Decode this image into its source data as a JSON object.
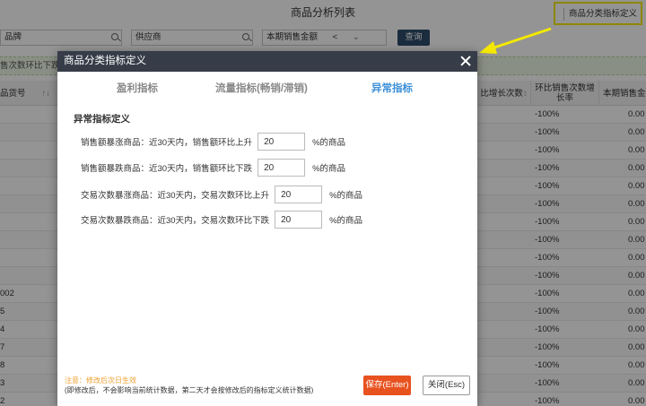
{
  "page": {
    "title": "商品分析列表",
    "def_button": "商品分类指标定义"
  },
  "filters": {
    "brand": "品牌",
    "supplier": "供应商",
    "sales": "本期销售金额",
    "sales_op": "<",
    "sales_chevron": "⌄",
    "query": "查询"
  },
  "notice": "售次数环比下跌",
  "table": {
    "headers": {
      "sku": "品货号",
      "sort_icon": "↑↓",
      "col_growth": "比增长次数",
      "col_growth_sort": "↕",
      "col_ratio": "环比销售次数增长率",
      "col_amount": "本期销售金"
    },
    "rows": [
      {
        "sku": "",
        "ratio": "-100%",
        "amount": "0.00"
      },
      {
        "sku": "",
        "ratio": "-100%",
        "amount": "0.00"
      },
      {
        "sku": "",
        "ratio": "-100%",
        "amount": "0.00"
      },
      {
        "sku": "",
        "ratio": "-100%",
        "amount": "0.00"
      },
      {
        "sku": "",
        "ratio": "-100%",
        "amount": "0.00"
      },
      {
        "sku": "",
        "ratio": "-100%",
        "amount": "0.00"
      },
      {
        "sku": "",
        "ratio": "-100%",
        "amount": "0.00"
      },
      {
        "sku": "",
        "ratio": "-100%",
        "amount": "0.00"
      },
      {
        "sku": "",
        "ratio": "-100%",
        "amount": "0.00"
      },
      {
        "sku": "",
        "ratio": "-100%",
        "amount": "0.00"
      },
      {
        "sku": "002",
        "ratio": "-100%",
        "amount": "0.00"
      },
      {
        "sku": "5",
        "ratio": "-100%",
        "amount": "0.00"
      },
      {
        "sku": "4",
        "ratio": "-100%",
        "amount": "0.00"
      },
      {
        "sku": "7",
        "ratio": "-100%",
        "amount": "0.00"
      },
      {
        "sku": "8",
        "ratio": "-100%",
        "amount": "0.00"
      },
      {
        "sku": "3",
        "ratio": "-100%",
        "amount": "0.00"
      },
      {
        "sku": "2",
        "ratio": "-100%",
        "amount": "0.00"
      }
    ]
  },
  "modal": {
    "title": "商品分类指标定义",
    "tabs": [
      {
        "label": "盈利指标",
        "active": false
      },
      {
        "label": "流量指标(畅销/滞销)",
        "active": false
      },
      {
        "label": "异常指标",
        "active": true
      }
    ],
    "section_title": "异常指标定义",
    "rules": [
      {
        "prefix": "销售额暴涨商品：近30天内，销售额环比上升",
        "value": "20",
        "suffix": "%的商品"
      },
      {
        "prefix": "销售额暴跌商品：近30天内，销售额环比下跌",
        "value": "20",
        "suffix": "%的商品"
      },
      {
        "prefix": "交易次数暴涨商品：近30天内，交易次数环比上升",
        "value": "20",
        "suffix": "%的商品"
      },
      {
        "prefix": "交易次数暴跌商品：近30天内，交易次数环比下跌",
        "value": "20",
        "suffix": "%的商品"
      }
    ],
    "note_warning": "注意：修改后次日生效",
    "note_detail": "(即修改后，不会影响当前统计数据，第二天才会按修改后的指标定义统计数据)",
    "save_label": "保存(Enter)",
    "close_label": "关闭(Esc)"
  },
  "colors": {
    "header_bg": "#363c48",
    "tab_active": "#3b8fd8",
    "save_bg": "#e8521f",
    "note_warning": "#f0a030",
    "highlight_border": "#f4e800",
    "arrow": "#f4e800"
  }
}
